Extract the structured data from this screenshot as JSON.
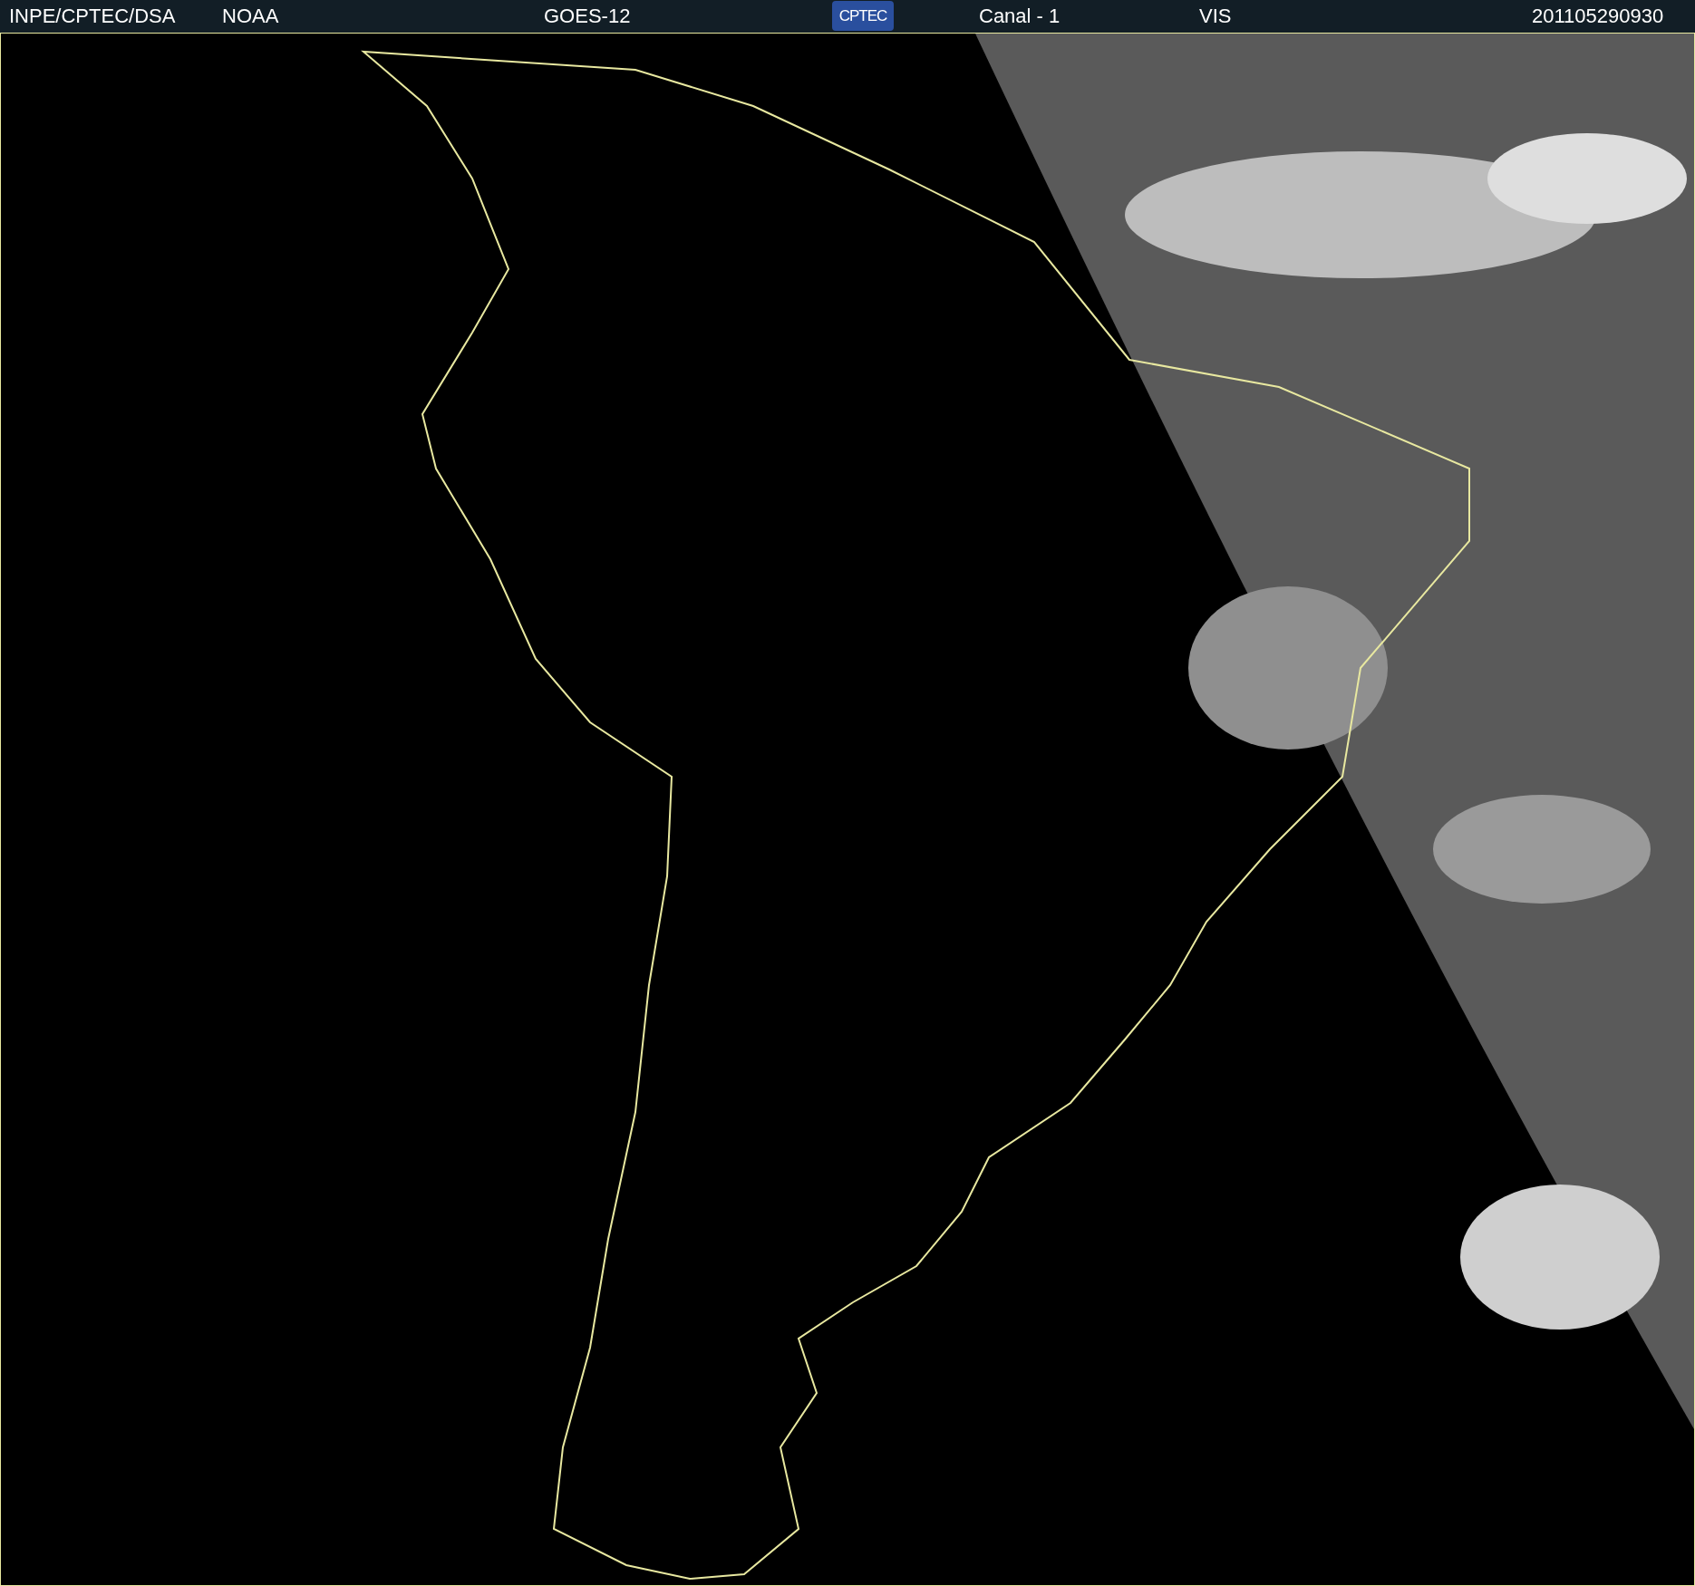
{
  "header": {
    "items": [
      {
        "kind": "text",
        "text": "INPE/CPTEC/DSA"
      },
      {
        "kind": "text",
        "text": "NOAA"
      },
      {
        "kind": "text",
        "text": "GOES-12"
      },
      {
        "kind": "logo",
        "text": "CPTEC"
      },
      {
        "kind": "text",
        "text": "Canal - 1"
      },
      {
        "kind": "text",
        "text": "VIS"
      },
      {
        "kind": "text",
        "text": "201105290930"
      }
    ]
  }
}
